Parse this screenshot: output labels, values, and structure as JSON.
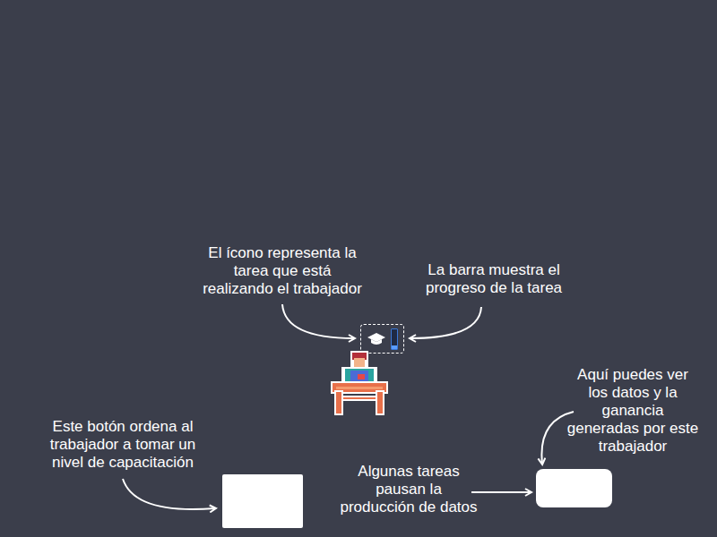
{
  "callouts": [
    {
      "id_hint": "task",
      "lines": [
        "El ícono representa la",
        "tarea que está",
        "realizando el trabajador"
      ]
    },
    {
      "id_hint": "bar",
      "lines": [
        "La barra muestra el",
        "progreso de la tarea"
      ]
    },
    {
      "id_hint": "training",
      "lines": [
        "Este botón ordena al",
        "trabajador a tomar un",
        "nivel de capacitación"
      ]
    },
    {
      "id_hint": "pause",
      "lines": [
        "Algunas tareas",
        "pausan la",
        "producción de datos"
      ]
    },
    {
      "id_hint": "data",
      "lines": [
        "Aquí puedes ver",
        "los datos y la",
        "ganancia",
        "generadas por este",
        "trabajador"
      ]
    }
  ],
  "task_progress": {
    "level": 0.15
  }
}
